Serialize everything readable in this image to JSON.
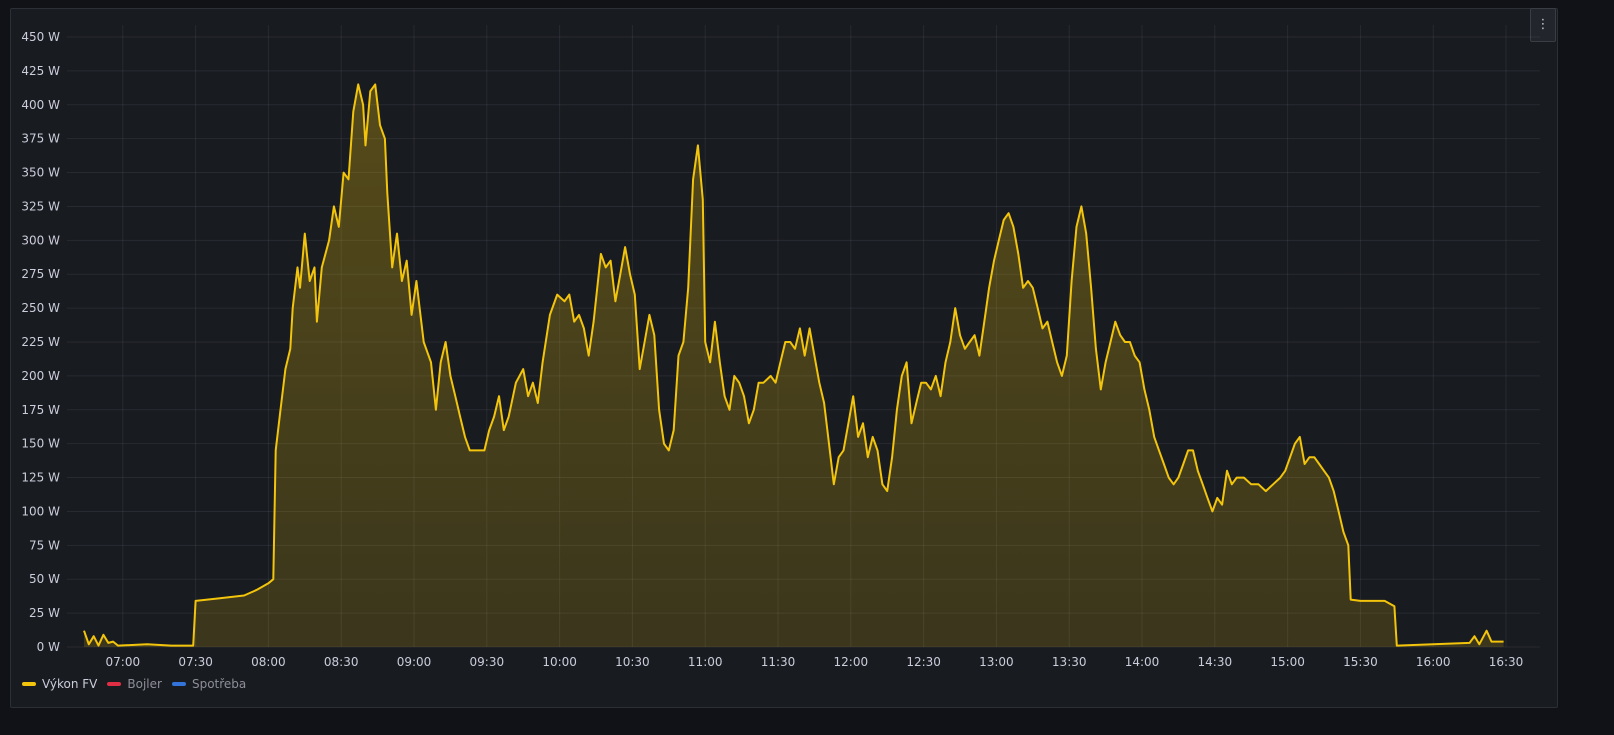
{
  "panel": {
    "menu_icon": "kebab-menu-icon"
  },
  "colors": {
    "vykon": "#f2c40c",
    "bojler": "#e02f44",
    "spotreba": "#3274d9"
  },
  "chart_data": {
    "type": "area",
    "title": "",
    "xlabel": "",
    "ylabel": "",
    "unit": "W",
    "ylim": [
      0,
      450
    ],
    "xlim": [
      "06:37",
      "16:44"
    ],
    "grid": true,
    "legend_position": "bottom-left",
    "y_ticks": [
      "0 W",
      "25 W",
      "50 W",
      "75 W",
      "100 W",
      "125 W",
      "150 W",
      "175 W",
      "200 W",
      "225 W",
      "250 W",
      "275 W",
      "300 W",
      "325 W",
      "350 W",
      "375 W",
      "400 W",
      "425 W",
      "450 W"
    ],
    "y_tick_values": [
      0,
      25,
      50,
      75,
      100,
      125,
      150,
      175,
      200,
      225,
      250,
      275,
      300,
      325,
      350,
      375,
      400,
      425,
      450
    ],
    "x_ticks": [
      "07:00",
      "07:30",
      "08:00",
      "08:30",
      "09:00",
      "09:30",
      "10:00",
      "10:30",
      "11:00",
      "11:30",
      "12:00",
      "12:30",
      "13:00",
      "13:30",
      "14:00",
      "14:30",
      "15:00",
      "15:30",
      "16:00",
      "16:30"
    ],
    "legend": [
      {
        "name": "Výkon FV",
        "active": true
      },
      {
        "name": "Bojler",
        "active": false
      },
      {
        "name": "Spotřeba",
        "active": false
      }
    ],
    "series": [
      {
        "name": "Výkon FV",
        "x": [
          "06:44",
          "06:46",
          "06:48",
          "06:50",
          "06:52",
          "06:54",
          "06:56",
          "06:58",
          "07:10",
          "07:20",
          "07:29",
          "07:30",
          "07:40",
          "07:50",
          "07:55",
          "08:00",
          "08:02",
          "08:03",
          "08:05",
          "08:07",
          "08:09",
          "08:10",
          "08:12",
          "08:13",
          "08:15",
          "08:17",
          "08:19",
          "08:20",
          "08:22",
          "08:25",
          "08:27",
          "08:29",
          "08:31",
          "08:33",
          "08:35",
          "08:37",
          "08:39",
          "08:40",
          "08:42",
          "08:44",
          "08:46",
          "08:48",
          "08:49",
          "08:51",
          "08:53",
          "08:55",
          "08:57",
          "08:59",
          "09:01",
          "09:04",
          "09:07",
          "09:09",
          "09:11",
          "09:13",
          "09:15",
          "09:17",
          "09:19",
          "09:21",
          "09:23",
          "09:26",
          "09:29",
          "09:31",
          "09:33",
          "09:35",
          "09:37",
          "09:39",
          "09:42",
          "09:45",
          "09:47",
          "09:49",
          "09:51",
          "09:53",
          "09:56",
          "09:59",
          "10:02",
          "10:04",
          "10:06",
          "10:08",
          "10:10",
          "10:12",
          "10:14",
          "10:17",
          "10:19",
          "10:21",
          "10:23",
          "10:25",
          "10:27",
          "10:29",
          "10:31",
          "10:33",
          "10:35",
          "10:37",
          "10:39",
          "10:41",
          "10:43",
          "10:45",
          "10:47",
          "10:49",
          "10:51",
          "10:53",
          "10:55",
          "10:57",
          "10:59",
          "11:00",
          "11:02",
          "11:04",
          "11:06",
          "11:08",
          "11:10",
          "11:12",
          "11:14",
          "11:16",
          "11:18",
          "11:20",
          "11:22",
          "11:24",
          "11:27",
          "11:29",
          "11:31",
          "11:33",
          "11:35",
          "11:37",
          "11:39",
          "11:41",
          "11:43",
          "11:45",
          "11:47",
          "11:49",
          "11:51",
          "11:53",
          "11:55",
          "11:57",
          "11:59",
          "12:01",
          "12:03",
          "12:05",
          "12:07",
          "12:09",
          "12:11",
          "12:13",
          "12:15",
          "12:17",
          "12:19",
          "12:21",
          "12:23",
          "12:25",
          "12:27",
          "12:29",
          "12:31",
          "12:33",
          "12:35",
          "12:37",
          "12:39",
          "12:41",
          "12:43",
          "12:45",
          "12:47",
          "12:49",
          "12:51",
          "12:53",
          "12:55",
          "12:57",
          "12:59",
          "13:01",
          "13:03",
          "13:05",
          "13:07",
          "13:09",
          "13:11",
          "13:13",
          "13:15",
          "13:17",
          "13:19",
          "13:21",
          "13:23",
          "13:25",
          "13:27",
          "13:29",
          "13:31",
          "13:33",
          "13:35",
          "13:37",
          "13:39",
          "13:41",
          "13:43",
          "13:45",
          "13:47",
          "13:49",
          "13:51",
          "13:53",
          "13:55",
          "13:57",
          "13:59",
          "14:01",
          "14:03",
          "14:05",
          "14:07",
          "14:09",
          "14:11",
          "14:13",
          "14:15",
          "14:17",
          "14:19",
          "14:21",
          "14:23",
          "14:25",
          "14:27",
          "14:29",
          "14:31",
          "14:33",
          "14:35",
          "14:37",
          "14:39",
          "14:42",
          "14:45",
          "14:48",
          "14:51",
          "14:54",
          "14:57",
          "14:59",
          "15:01",
          "15:03",
          "15:05",
          "15:07",
          "15:09",
          "15:11",
          "15:13",
          "15:15",
          "15:17",
          "15:19",
          "15:21",
          "15:23",
          "15:25",
          "15:26",
          "15:30",
          "15:40",
          "15:44",
          "15:45",
          "16:00",
          "16:15",
          "16:17",
          "16:19",
          "16:22",
          "16:24",
          "16:29"
        ],
        "values": [
          12,
          2,
          8,
          1,
          9,
          3,
          4,
          1,
          2,
          1,
          1,
          34,
          36,
          38,
          42,
          47,
          50,
          145,
          175,
          205,
          220,
          250,
          280,
          265,
          305,
          270,
          280,
          240,
          280,
          300,
          325,
          310,
          350,
          345,
          395,
          415,
          400,
          370,
          410,
          415,
          385,
          375,
          335,
          280,
          305,
          270,
          285,
          245,
          270,
          225,
          210,
          175,
          210,
          225,
          200,
          185,
          170,
          155,
          145,
          145,
          145,
          160,
          170,
          185,
          160,
          170,
          195,
          205,
          185,
          195,
          180,
          210,
          245,
          260,
          255,
          260,
          240,
          245,
          235,
          215,
          240,
          290,
          280,
          285,
          255,
          275,
          295,
          275,
          260,
          205,
          225,
          245,
          230,
          175,
          150,
          145,
          160,
          215,
          225,
          265,
          345,
          370,
          330,
          225,
          210,
          240,
          210,
          185,
          175,
          200,
          195,
          185,
          165,
          175,
          195,
          195,
          200,
          195,
          210,
          225,
          225,
          220,
          235,
          215,
          235,
          215,
          195,
          180,
          150,
          120,
          140,
          145,
          165,
          185,
          155,
          165,
          140,
          155,
          145,
          120,
          115,
          140,
          175,
          200,
          210,
          165,
          180,
          195,
          195,
          190,
          200,
          185,
          210,
          225,
          250,
          230,
          220,
          225,
          230,
          215,
          240,
          265,
          285,
          300,
          315,
          320,
          310,
          290,
          265,
          270,
          265,
          250,
          235,
          240,
          225,
          210,
          200,
          215,
          270,
          310,
          325,
          305,
          265,
          220,
          190,
          210,
          225,
          240,
          230,
          225,
          225,
          215,
          210,
          190,
          175,
          155,
          145,
          135,
          125,
          120,
          125,
          135,
          145,
          145,
          130,
          120,
          110,
          100,
          110,
          105,
          130,
          120,
          125,
          125,
          120,
          120,
          115,
          120,
          125,
          130,
          140,
          150,
          155,
          135,
          140,
          140,
          135,
          130,
          125,
          115,
          100,
          85,
          75,
          35,
          34,
          34,
          30,
          1,
          2,
          3,
          8,
          2,
          12,
          4,
          4
        ]
      },
      {
        "name": "Bojler",
        "x": [],
        "values": []
      },
      {
        "name": "Spotřeba",
        "x": [],
        "values": []
      }
    ]
  }
}
